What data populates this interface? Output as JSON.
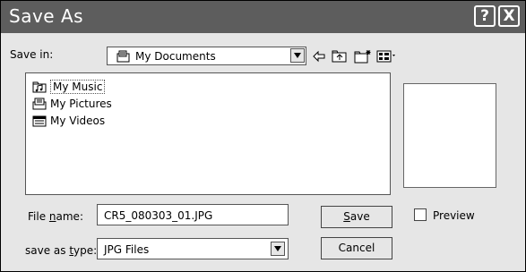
{
  "dialog": {
    "title": "Save As",
    "help_button": "?",
    "close_button": "X"
  },
  "save_in": {
    "label": "Save in:",
    "value": "My Documents"
  },
  "toolbar_icons": [
    "back-arrow-icon",
    "up-folder-icon",
    "new-folder-icon",
    "view-menu-icon"
  ],
  "file_list": [
    {
      "name": "My Music",
      "icon": "music-folder-icon",
      "focused": true
    },
    {
      "name": "My Pictures",
      "icon": "pictures-folder-icon",
      "focused": false
    },
    {
      "name": "My Videos",
      "icon": "videos-folder-icon",
      "focused": false
    }
  ],
  "file_name": {
    "label_before": "File ",
    "label_underlined": "n",
    "label_after": "ame:",
    "value": "CR5_080303_01.JPG"
  },
  "save_as_type": {
    "label_before": "save as ",
    "label_underlined": "t",
    "label_after": "ype:",
    "value": "JPG Files"
  },
  "buttons": {
    "save_underlined": "S",
    "save_rest": "ave",
    "cancel": "Cancel"
  },
  "preview": {
    "label": "Preview",
    "checked": false
  }
}
